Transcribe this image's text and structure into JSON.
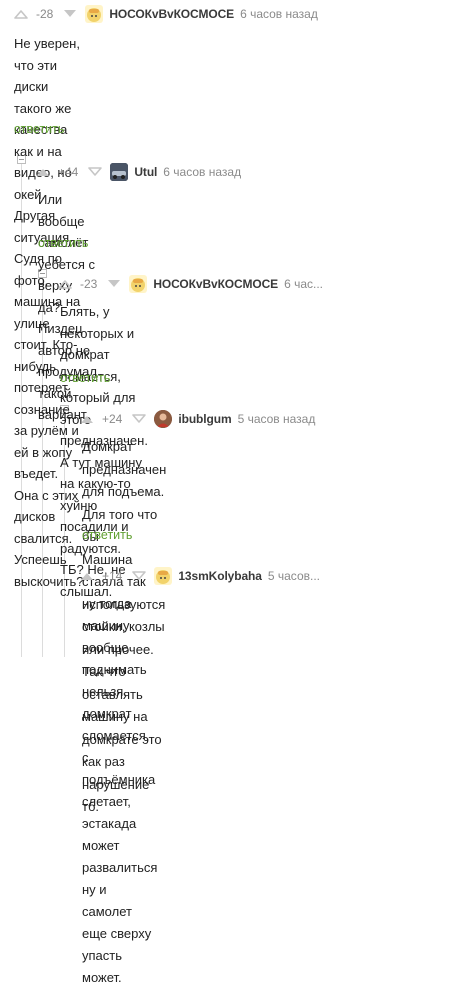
{
  "comments": [
    {
      "rating": "-28",
      "nick": "НОСОКvВvКОСМОСЕ",
      "time": "6 часов назад",
      "avatar": "sock-cartoon-avatar",
      "lines": [
        "Не уверен, что эти диски такого же качества как и на видео, но окей.",
        "Другая ситуация. Судя по фото, машина на улице стоит. Кто-нибудь",
        "потеряет сознание за рулём и ей в жопу въедет. Она с этих дисков",
        "свалится. Успеешь выскочить?"
      ],
      "reply": "ответить"
    },
    {
      "rating": "+44",
      "nick": "Utul",
      "time": "6 часов назад",
      "avatar": "car-photo-avatar",
      "lines": [
        "Или вообще самолёт уебется с верху да? Пиздец автор не продумал",
        "такой вариант."
      ],
      "reply": "ответить"
    },
    {
      "rating": "-23",
      "nick": "НОСОКvВvКОСМОСЕ",
      "time": "6 час...",
      "avatar": "sock-cartoon-avatar",
      "lines": [
        "Блять, у некоторых и домкрат ломается, который для этого",
        "предназначен. А тут машину на какую-то хуйню посадили и",
        "радуются. ТБ? Не, не слышал."
      ],
      "reply": "ответить"
    },
    {
      "rating": "+24",
      "nick": "ibublgum",
      "time": "5 часов назад",
      "avatar": "person-avatar",
      "lines": [
        "Домкрат предназначен для подъема. Для того что бы",
        "Машина стаяла так используются стойки, козлы или прочее.",
        "Так что оставлять машину на домкрате это как раз",
        "нарушение тб."
      ],
      "reply": "ответить"
    },
    {
      "rating": "+14",
      "nick": "13smKolybaha",
      "time": "5 часов...",
      "avatar": "sock-cartoon-avatar",
      "lines": [
        "ну тогда машину вообще поднимать нельзя. домкрат",
        "сломается, с подъёмника слетает, эстакада может",
        "развалиться ну и самолет еще сверху упасть может."
      ],
      "reply": ""
    }
  ],
  "colors": {
    "accent": "#5f9f30",
    "arrow": "#c6c6c6",
    "muted": "#8a8a8a"
  }
}
